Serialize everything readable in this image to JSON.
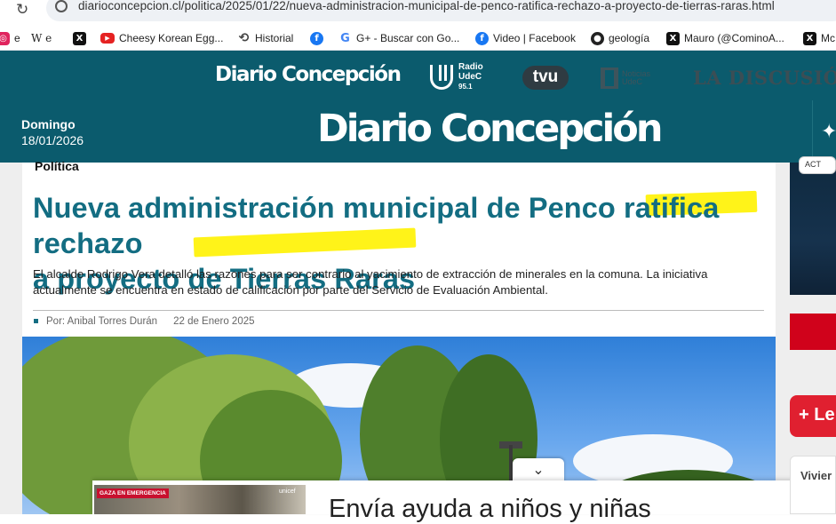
{
  "browser": {
    "url": "diarioconcepcion.cl/politica/2025/01/22/nueva-administracion-municipal-de-penco-ratifica-rechazo-a-proyecto-de-tierras-raras.html",
    "reload_glyph": "↻",
    "bookmarks": [
      {
        "label": "e",
        "icon": "instagram-icon"
      },
      {
        "label": "W e",
        "icon": "wikipedia-icon"
      },
      {
        "label": "",
        "icon": "x-icon"
      },
      {
        "label": "Cheesy Korean Egg...",
        "icon": "youtube-icon"
      },
      {
        "label": "Historial",
        "icon": "history-icon"
      },
      {
        "label": "",
        "icon": "facebook-icon"
      },
      {
        "label": "G+ - Buscar con Go...",
        "icon": "google-icon"
      },
      {
        "label": "Video | Facebook",
        "icon": "facebook-icon"
      },
      {
        "label": "geología",
        "icon": "github-icon"
      },
      {
        "label": "Mauro (@CominoA...",
        "icon": "x-icon"
      },
      {
        "label": "Mc",
        "icon": "x-icon"
      }
    ]
  },
  "site": {
    "topnav": {
      "brand": "Diario Concepción",
      "radio_name": "Radio",
      "radio_sub": "UdeC",
      "radio_freq": "95.1",
      "tvu": "tvu",
      "tvu_sub1": "Noticias",
      "tvu_sub2": "UdeC",
      "other": "LA DISCUSIÓN"
    },
    "header": {
      "day": "Domingo",
      "date": "18/01/2026",
      "logo": "Diario Concepción",
      "menu_glyph": "✦"
    }
  },
  "article": {
    "section": "Política",
    "headline_line1": "Nueva administración municipal de Penco ratifica rechazo",
    "headline_line2": "a proyecto de Tierras Raras",
    "lede": "El alcalde Rodrigo Vera detalló las razones para ser contrario al yacimiento de extracción de minerales en la comuna. La iniciativa actualmente se encuentra en estado de calificación por parte del Servicio de Evaluación Ambiental.",
    "author": "Por: Anibal Torres Durán",
    "date": "22 de Enero 2025"
  },
  "photo": {
    "chevron": "⌄"
  },
  "ad": {
    "badge": "GAZA EN EMERGENCIA",
    "logo": "unicef",
    "text": "Envía ayuda a niños y niñas"
  },
  "rail": {
    "act": "ACT",
    "button": "+ Le",
    "card": "Vivier"
  }
}
